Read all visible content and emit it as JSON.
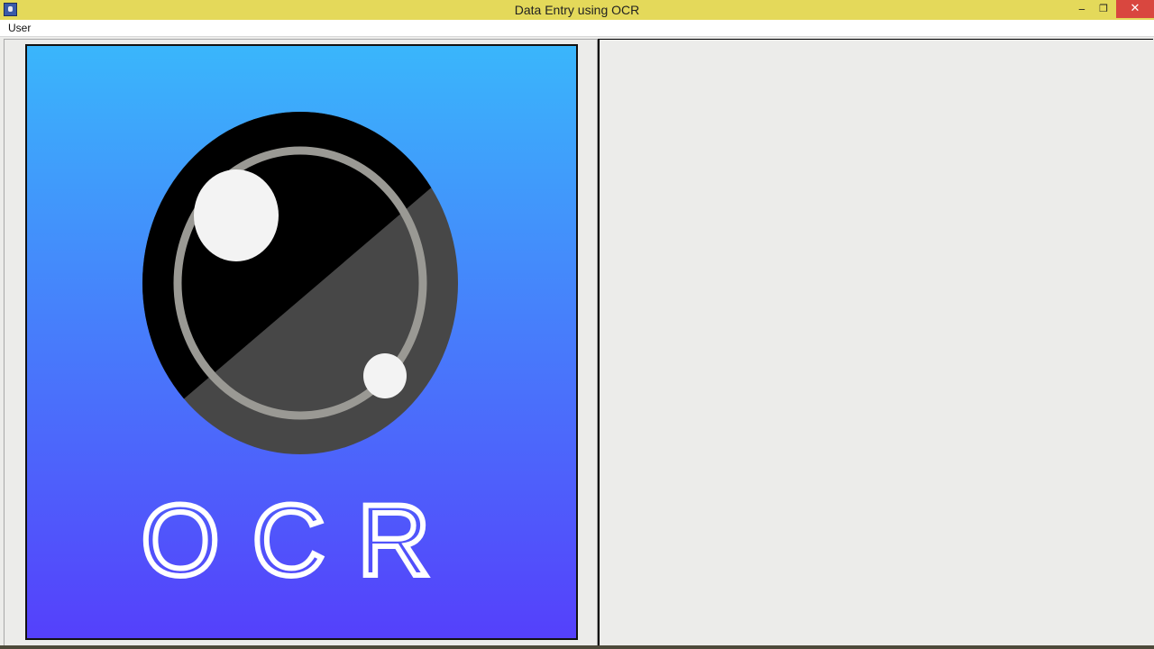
{
  "window": {
    "title": "Data Entry using OCR",
    "minimize_glyph": "‒",
    "restore_glyph": "❐",
    "close_glyph": "✕"
  },
  "menu": {
    "items": [
      {
        "label": "User"
      }
    ]
  },
  "logo": {
    "text": "OCR"
  },
  "colors": {
    "titlebar": "#e4d95a",
    "close_button": "#d9473f",
    "logo_gradient_top": "#3ab6fb",
    "logo_gradient_bottom": "#5540fb"
  },
  "icons": [
    "app-icon",
    "minimize-icon",
    "restore-icon",
    "close-icon",
    "ocr-lens-icon"
  ]
}
